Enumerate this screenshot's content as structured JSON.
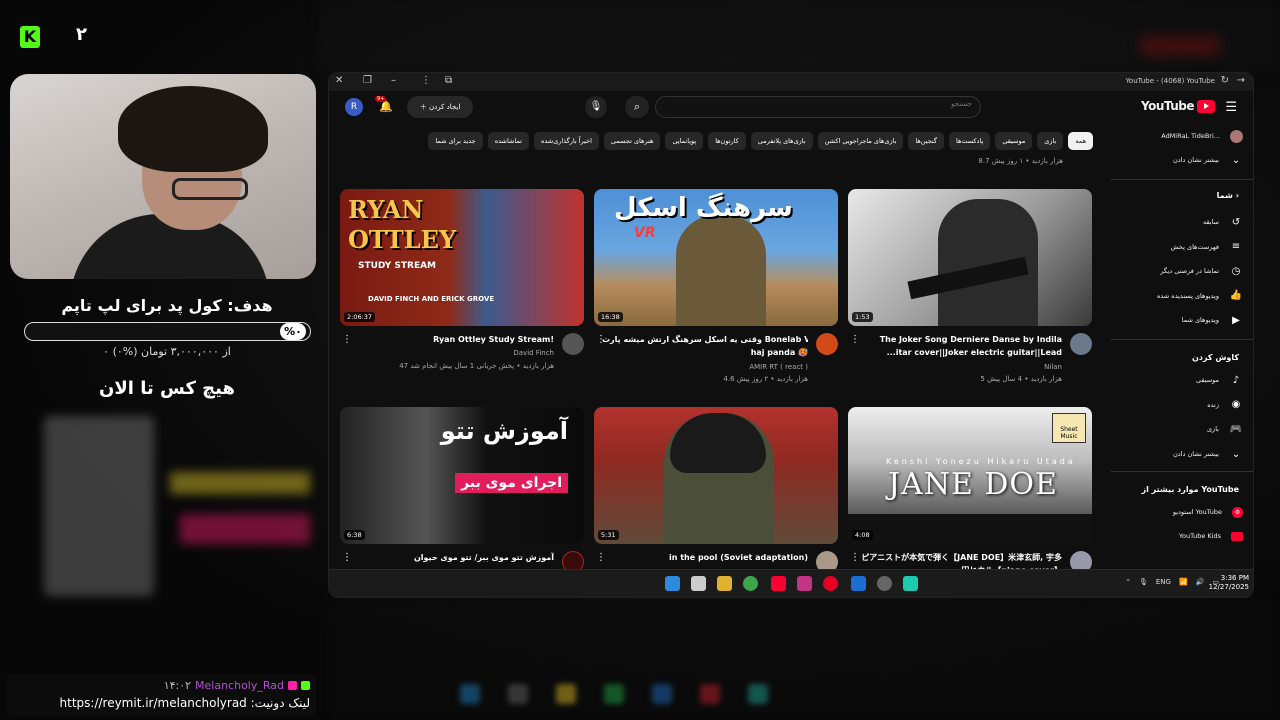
{
  "overlay": {
    "viewer_count": "۲",
    "goal_title": "هدف: کول پد برای لپ تاپم",
    "goal_percent": "%۰",
    "goal_progress": 0,
    "goal_amount": "۰ از ۳,۰۰۰,۰۰۰ تومان (%۰)",
    "top_donor": "هیچ کس تا الان",
    "chat": {
      "time": "۱۴:۰۲",
      "username": "Melancholy_Rad",
      "message": "لینک دونیت: https://reymit.ir/melancholyrad"
    }
  },
  "browser": {
    "window_title": "YouTube - (4068) YouTube",
    "youtube": {
      "logo_text": "YouTube",
      "search_placeholder": "جستجو",
      "create_label": "ایجاد کردن",
      "notification_count": "9+",
      "avatar_letter": "R",
      "chips": [
        "همه",
        "بازی",
        "موسیقی",
        "پادکست‌ها",
        "گنجین‌ها",
        "بازی‌های ماجراجویی اکشن",
        "بازی‌های پلاتفرمی",
        "کارتون‌ها",
        "پویانمایی",
        "هنرهای تجسمی",
        "اخیراً بارگذاری‌شده",
        "تماشاشده",
        "جدید برای شما"
      ],
      "top_meta": "8.7 هزار بازدید • ۱ روز پیش",
      "sidebar": {
        "account_name": "AdMiRaL TideBri...",
        "show_more_1": "بیشتر نشان دادن",
        "you_header": "شما",
        "you_items": [
          "سابقه",
          "فهرست‌های پخش",
          "تماشا در فرصتی دیگر",
          "ویدیوهای پسندیده شده",
          "ویدیوهای شما"
        ],
        "explore_header": "کاوش کردن",
        "explore_items": [
          "موسیقی",
          "زنده",
          "بازی"
        ],
        "show_more_2": "بیشتر نشان دادن",
        "more_header": "موارد بیشتر از YouTube",
        "more_items": [
          "استودیو YouTube",
          "YouTube Kids"
        ]
      },
      "videos": [
        {
          "title": "The Joker Song Derniere Danse by Indila ...itar cover||Joker electric guitar||Lead Guitar",
          "channel": "Nilan",
          "meta": "5 هزار بازدید • 4 سال پیش",
          "duration": "1:53"
        },
        {
          "title": "وقتی یه اسکل سرهنگ ارتش میشه پارت Bonelab VR 2",
          "title2": "haj panda 🥵",
          "channel": "AMIR RT ( react )",
          "meta": "4.6 هزار بازدید • ۲ روز پیش",
          "duration": "16:38",
          "thumb_text": "سرهنگ اسکل",
          "thumb_badge": "VR"
        },
        {
          "title": "Ryan Ottley Study Stream!",
          "channel": "David Finch",
          "meta": "47 هزار بازدید • پخش جریانی 1 سال پیش انجام شد",
          "duration": "2:06:37",
          "thumb_line1": "RYAN",
          "thumb_line2": "OTTLEY",
          "thumb_sub": "STUDY STREAM",
          "thumb_sub2": "DAVID FINCH AND ERICK GROVE"
        },
        {
          "title": "ピアニストが本気で弾く【JANE DOE】米津玄師, 宇多田ヒカル【piano cover】",
          "channel": "",
          "meta": "",
          "duration": "4:08",
          "thumb_text": "JANE DOE",
          "thumb_sub": "Kenshi Yonezu Hikaru Utada",
          "thumb_badge": "Sheet Music"
        },
        {
          "title": "in the pool (Soviet adaptation)",
          "channel": "",
          "meta": "",
          "duration": "5:31"
        },
        {
          "title": "آموزش تتو موی ببر/ تتو موی حیوان",
          "channel": "",
          "meta": "",
          "duration": "6:38",
          "thumb_line1": "آموزش تتو",
          "thumb_line2": "اجرای موی ببر"
        }
      ]
    },
    "taskbar": {
      "language": "ENG",
      "time": "3:36 PM",
      "date": "12/27/2025"
    }
  }
}
